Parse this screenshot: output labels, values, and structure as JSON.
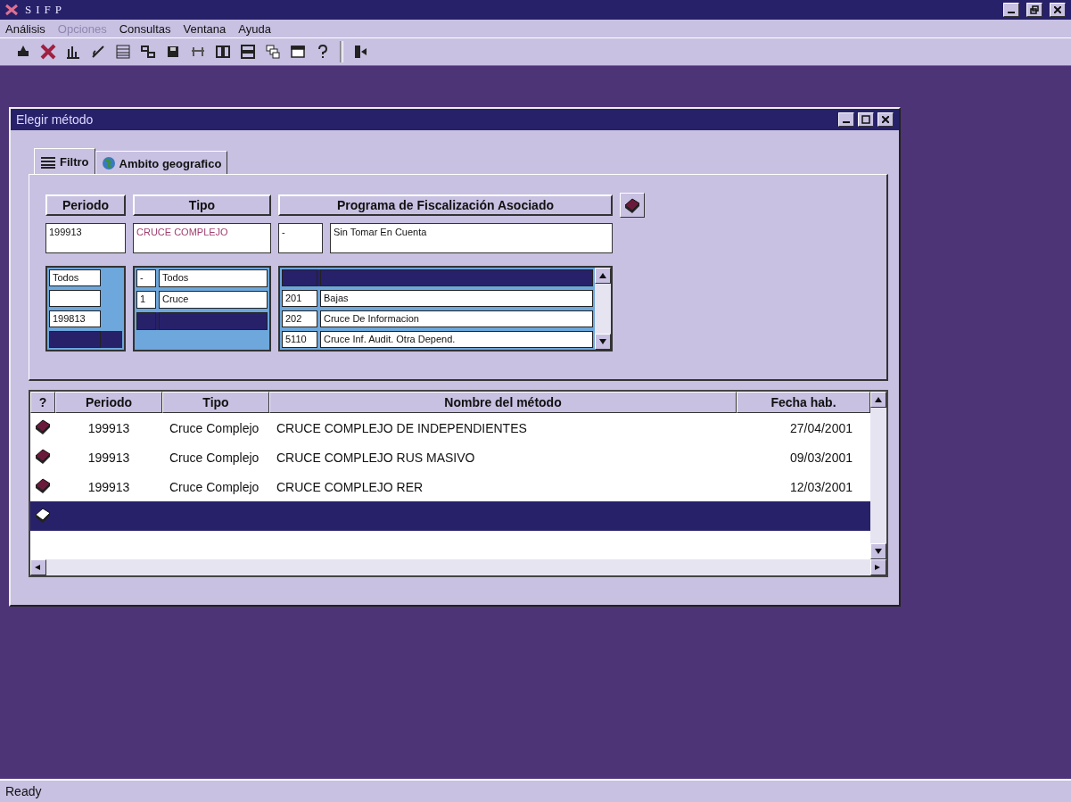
{
  "app": {
    "title": "SIFP"
  },
  "menu": [
    {
      "label": "Análisis",
      "disabled": false
    },
    {
      "label": "Opciones",
      "disabled": true
    },
    {
      "label": "Consultas",
      "disabled": false
    },
    {
      "label": "Ventana",
      "disabled": false
    },
    {
      "label": "Ayuda",
      "disabled": false
    }
  ],
  "child_window": {
    "title": "Elegir método",
    "tabs": [
      {
        "label": "Filtro",
        "selected": true
      },
      {
        "label": "Ambito geografico",
        "selected": false
      }
    ],
    "filter": {
      "headers": [
        "Periodo",
        "Tipo",
        "Programa de Fiscalización Asociado"
      ],
      "periodo_value": "199913",
      "tipo_value": "CRUCE COMPLEJO",
      "programa_code": "-",
      "programa_name": "Sin Tomar En Cuenta",
      "periodo_list": [
        {
          "label": "Todos",
          "selected": false
        },
        {
          "selected": false
        },
        {
          "label": "199813",
          "selected": false
        },
        {
          "selected": true
        }
      ],
      "tipo_list": [
        {
          "code": "-",
          "label": "Todos",
          "selected": false
        },
        {
          "code": "1",
          "label": "Cruce",
          "selected": false
        },
        {
          "selected": true
        }
      ],
      "programa_list": [
        {
          "selected": true
        },
        {
          "code": "201",
          "label": "Bajas",
          "selected": false
        },
        {
          "code": "202",
          "label": "Cruce De Informacion",
          "selected": false
        },
        {
          "code": "5110",
          "label": "Cruce Inf. Audit. Otra Depend.",
          "selected": false
        }
      ]
    },
    "grid": {
      "columns": [
        "?",
        "Periodo",
        "Tipo",
        "Nombre del método",
        "Fecha hab."
      ],
      "rows": [
        {
          "periodo": "199913",
          "tipo": "Cruce Complejo",
          "nombre": "CRUCE COMPLEJO DE INDEPENDIENTES",
          "fecha": "27/04/2001",
          "selected": false
        },
        {
          "periodo": "199913",
          "tipo": "Cruce Complejo",
          "nombre": "CRUCE COMPLEJO RUS MASIVO",
          "fecha": "09/03/2001",
          "selected": false
        },
        {
          "periodo": "199913",
          "tipo": "Cruce Complejo",
          "nombre": "CRUCE COMPLEJO RER",
          "fecha": "12/03/2001",
          "selected": false
        },
        {
          "selected": true
        }
      ]
    }
  },
  "status_bar": {
    "text": "Ready"
  }
}
